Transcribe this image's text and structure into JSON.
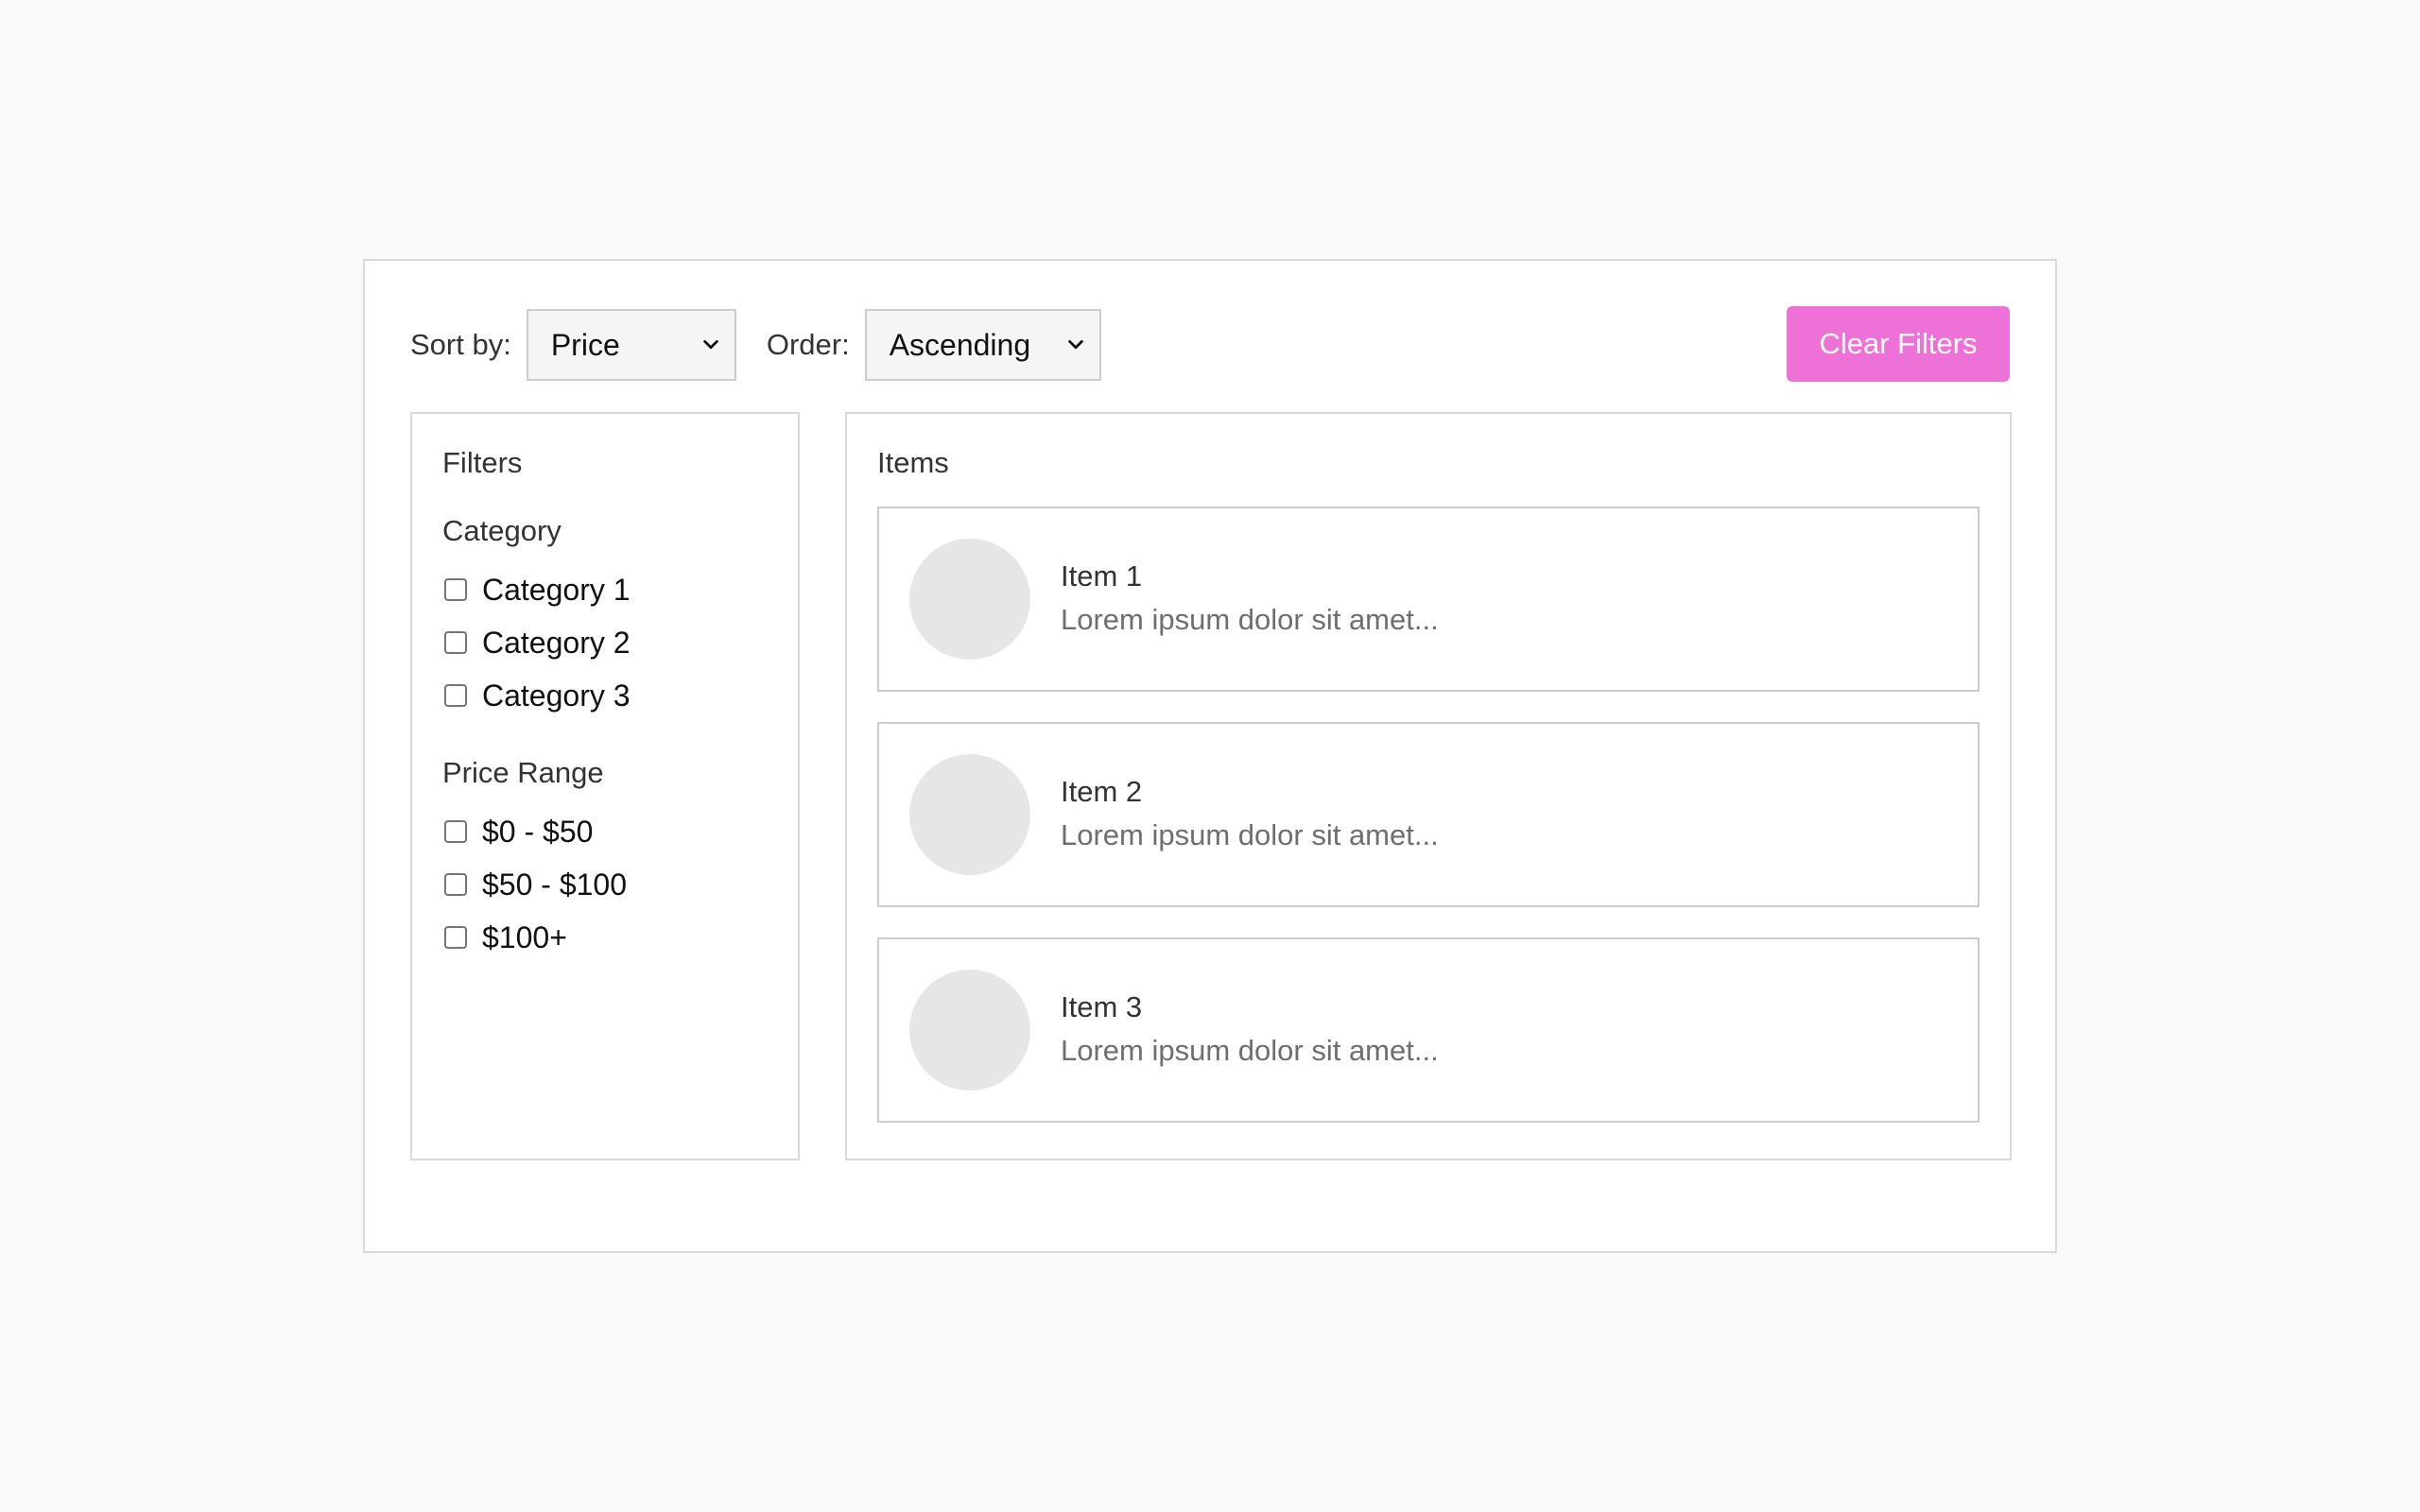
{
  "toolbar": {
    "sort_label": "Sort by:",
    "sort_value": "Price",
    "order_label": "Order:",
    "order_value": "Ascending",
    "clear_label": "Clear Filters"
  },
  "filters": {
    "title": "Filters",
    "category": {
      "title": "Category",
      "options": [
        {
          "label": "Category 1",
          "checked": false
        },
        {
          "label": "Category 2",
          "checked": false
        },
        {
          "label": "Category 3",
          "checked": false
        }
      ]
    },
    "price": {
      "title": "Price Range",
      "options": [
        {
          "label": "$0 - $50",
          "checked": false
        },
        {
          "label": "$50 - $100",
          "checked": false
        },
        {
          "label": "$100+",
          "checked": false
        }
      ]
    }
  },
  "items": {
    "title": "Items",
    "list": [
      {
        "name": "Item 1",
        "description": "Lorem ipsum dolor sit amet..."
      },
      {
        "name": "Item 2",
        "description": "Lorem ipsum dolor sit amet..."
      },
      {
        "name": "Item 3",
        "description": "Lorem ipsum dolor sit amet..."
      }
    ]
  },
  "colors": {
    "accent": "#ee71d8",
    "background": "#f9f9f9",
    "avatar_placeholder": "#e6e6e6"
  },
  "icons": {
    "select_arrow": "chevron-down-icon"
  }
}
